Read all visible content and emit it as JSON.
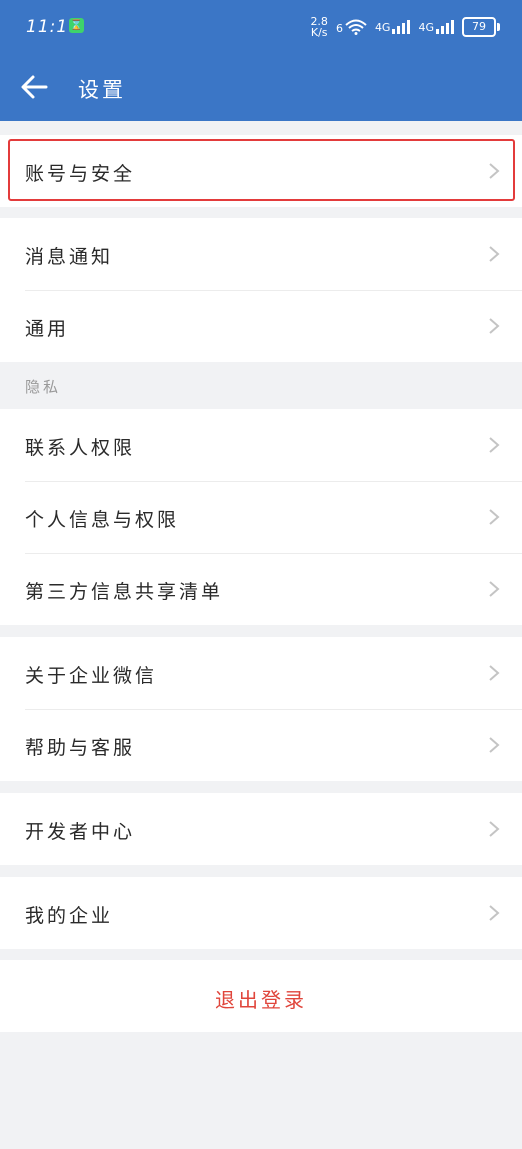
{
  "status": {
    "time": "11:17",
    "net_speed_value": "2.8",
    "net_speed_unit": "K/s",
    "wifi_label": "6",
    "signal1_label": "4G",
    "signal2_label": "4G",
    "battery": "79"
  },
  "header": {
    "title": "设置",
    "background_color": "#3b76c6"
  },
  "groups": [
    {
      "items": [
        {
          "label": "账号与安全",
          "icon": "chevron-right-icon",
          "highlighted": true
        }
      ]
    },
    {
      "items": [
        {
          "label": "消息通知"
        },
        {
          "label": "通用"
        }
      ]
    },
    {
      "caption": "隐私",
      "items": [
        {
          "label": "联系人权限"
        },
        {
          "label": "个人信息与权限"
        },
        {
          "label": "第三方信息共享清单"
        }
      ]
    },
    {
      "items": [
        {
          "label": "关于企业微信"
        },
        {
          "label": "帮助与客服"
        }
      ]
    },
    {
      "items": [
        {
          "label": "开发者中心"
        }
      ]
    },
    {
      "items": [
        {
          "label": "我的企业"
        }
      ]
    }
  ],
  "logout": {
    "label": "退出登录",
    "color": "#e0453b"
  }
}
